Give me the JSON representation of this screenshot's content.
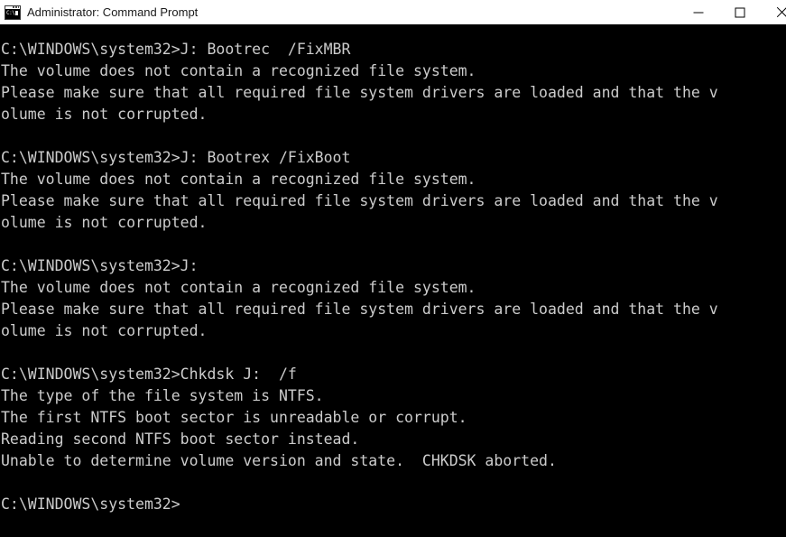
{
  "window": {
    "title": "Administrator: Command Prompt",
    "icon": "command-prompt-icon",
    "icon_glyph_text": "C:\\",
    "background_color": "#000000",
    "titlebar_background_color": "#ffffff",
    "titlebar_text_color": "#1a1a1a",
    "console_text_color": "#cccccc",
    "controls": {
      "minimize_label": "—",
      "maximize_label": "□",
      "close_label": "✕"
    }
  },
  "console": {
    "prompt": "C:\\WINDOWS\\system32>",
    "lines": [
      "C:\\WINDOWS\\system32>J: Bootrec  /FixMBR",
      "The volume does not contain a recognized file system.",
      "Please make sure that all required file system drivers are loaded and that the v",
      "olume is not corrupted.",
      "",
      "C:\\WINDOWS\\system32>J: Bootrex /FixBoot",
      "The volume does not contain a recognized file system.",
      "Please make sure that all required file system drivers are loaded and that the v",
      "olume is not corrupted.",
      "",
      "C:\\WINDOWS\\system32>J:",
      "The volume does not contain a recognized file system.",
      "Please make sure that all required file system drivers are loaded and that the v",
      "olume is not corrupted.",
      "",
      "C:\\WINDOWS\\system32>Chkdsk J:  /f",
      "The type of the file system is NTFS.",
      "The first NTFS boot sector is unreadable or corrupt.",
      "Reading second NTFS boot sector instead.",
      "Unable to determine volume version and state.  CHKDSK aborted.",
      "",
      "C:\\WINDOWS\\system32>"
    ],
    "commands": [
      "J: Bootrec  /FixMBR",
      "J: Bootrex /FixBoot",
      "J:",
      "Chkdsk J:  /f"
    ]
  }
}
